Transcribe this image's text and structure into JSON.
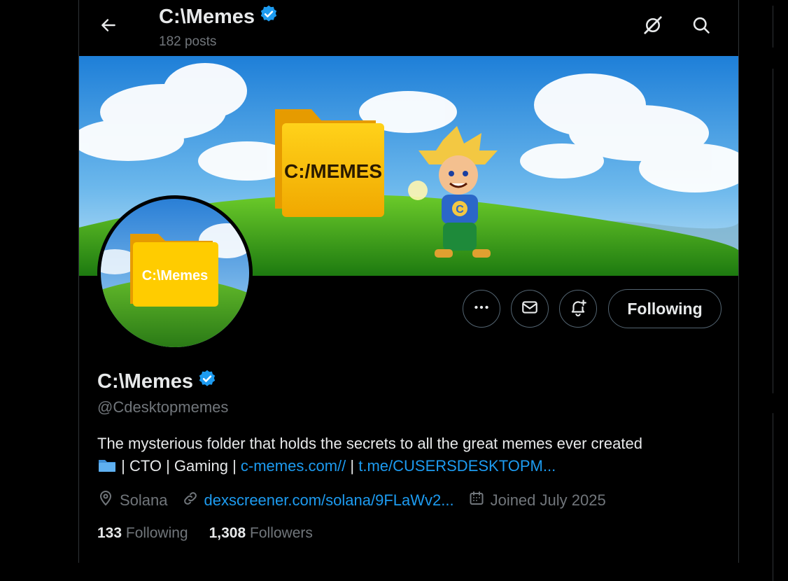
{
  "header": {
    "name": "C:\\Memes",
    "post_count": "182 posts"
  },
  "banner": {
    "folder_label": "C:/MEMES",
    "mascot_letter": "C"
  },
  "avatar": {
    "folder_label": "C:\\Memes"
  },
  "actions": {
    "follow_label": "Following"
  },
  "profile": {
    "name": "C:\\Memes",
    "handle": "@Cdesktopmemes",
    "bio_text": "The mysterious folder that holds the secrets to all the great memes ever created",
    "bio_tags": " | CTO | Gaming | ",
    "bio_link1": "c-memes.com//",
    "bio_sep": " | ",
    "bio_link2": "t.me/CUSERSDESKTOPM...",
    "location": "Solana",
    "website": "dexscreener.com/solana/9FLaWv2...",
    "joined": "Joined July 2025",
    "following_count": "133",
    "following_label": "Following",
    "followers_count": "1,308",
    "followers_label": "Followers"
  },
  "colors": {
    "accent": "#1d9bf0",
    "verified": "#1d9bf0",
    "muted": "#71767b",
    "border": "#536471"
  },
  "icons": [
    "back-arrow-icon",
    "verified-badge-icon",
    "grok-icon",
    "search-icon",
    "more-icon",
    "message-icon",
    "notification-bell-icon",
    "folder-emoji-icon",
    "location-icon",
    "link-icon",
    "calendar-icon"
  ]
}
